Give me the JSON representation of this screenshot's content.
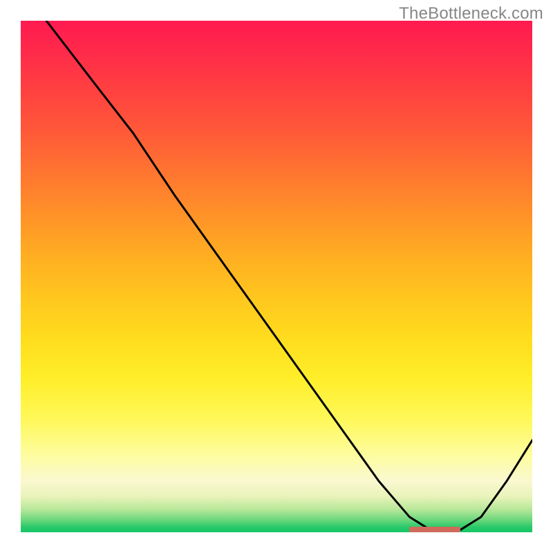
{
  "watermark": "TheBottleneck.com",
  "chart_data": {
    "type": "line",
    "title": "",
    "xlabel": "",
    "ylabel": "",
    "xlim": [
      0,
      100
    ],
    "ylim": [
      0,
      100
    ],
    "series": [
      {
        "name": "curve",
        "x": [
          0,
          5,
          15,
          22,
          30,
          40,
          50,
          60,
          70,
          76,
          80,
          86,
          90,
          95,
          100
        ],
        "y": [
          107,
          100,
          87,
          78,
          66,
          52,
          38,
          24,
          10,
          3,
          0.5,
          0.5,
          3,
          10,
          18
        ]
      }
    ],
    "flat_segment": {
      "x_start": 76,
      "x_end": 86,
      "y": 0.5
    },
    "background_gradient": {
      "stops": [
        {
          "pos": 0,
          "color": "#ff1a50"
        },
        {
          "pos": 0.5,
          "color": "#ffc61e"
        },
        {
          "pos": 0.8,
          "color": "#fff85a"
        },
        {
          "pos": 0.95,
          "color": "#b8e89a"
        },
        {
          "pos": 1.0,
          "color": "#16c666"
        }
      ]
    }
  }
}
